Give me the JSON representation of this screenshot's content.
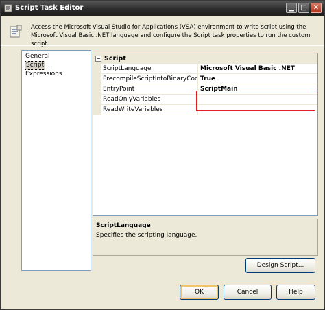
{
  "window": {
    "title": "Script Task Editor",
    "icons": {
      "app": "script-task-icon",
      "minimize": "minimize-icon",
      "maximize": "maximize-icon",
      "close": "close-icon"
    }
  },
  "header": {
    "icon": "script-icon",
    "description": "Access the Microsoft Visual Studio for Applications (VSA) environment to write script using the Microsoft Visual Basic .NET language and configure the Script task properties to run the custom script."
  },
  "nav": {
    "items": [
      {
        "label": "General",
        "selected": false
      },
      {
        "label": "Script",
        "selected": true
      },
      {
        "label": "Expressions",
        "selected": false
      }
    ]
  },
  "property_grid": {
    "category": {
      "label": "Script",
      "expander": "minus-icon"
    },
    "rows": [
      {
        "name": "ScriptLanguage",
        "value": "Microsoft Visual Basic .NET"
      },
      {
        "name": "PrecompileScriptIntoBinaryCode",
        "value": "True"
      },
      {
        "name": "EntryPoint",
        "value": "ScriptMain"
      },
      {
        "name": "ReadOnlyVariables",
        "value": ""
      },
      {
        "name": "ReadWriteVariables",
        "value": ""
      }
    ]
  },
  "description_panel": {
    "title": "ScriptLanguage",
    "text": "Specifies the scripting language."
  },
  "buttons": {
    "design_script": "Design Script...",
    "ok": "OK",
    "cancel": "Cancel",
    "help": "Help"
  },
  "colors": {
    "highlight": "#e0202a",
    "titlebar": "#2c2c2c",
    "dialog": "#ece9d8"
  }
}
